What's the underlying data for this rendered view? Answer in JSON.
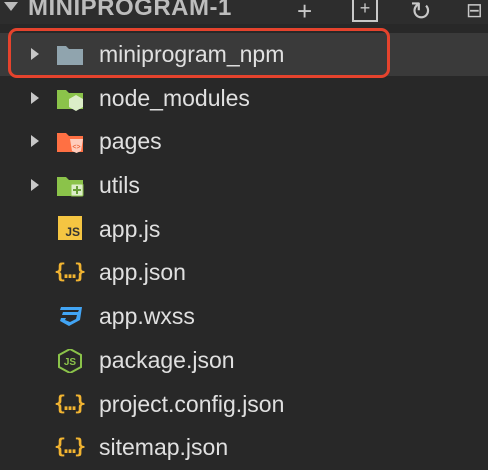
{
  "header": {
    "title": "MINIPROGRAM-1",
    "actions": [
      "new-file",
      "new-folder",
      "refresh",
      "collapse-all"
    ]
  },
  "tree": [
    {
      "label": "miniprogram_npm",
      "type": "folder",
      "icon": "folder-icon",
      "color": "#90a4ae",
      "selected": true
    },
    {
      "label": "node_modules",
      "type": "folder",
      "icon": "folder-node-icon",
      "color": "#8bc34a"
    },
    {
      "label": "pages",
      "type": "folder",
      "icon": "folder-html-icon",
      "color": "#ff7043"
    },
    {
      "label": "utils",
      "type": "folder",
      "icon": "folder-utils-icon",
      "color": "#8bc34a"
    },
    {
      "label": "app.js",
      "type": "file",
      "icon": "js-file-icon",
      "color": "#f5c542"
    },
    {
      "label": "app.json",
      "type": "file",
      "icon": "json-file-icon",
      "color": "#f2b431"
    },
    {
      "label": "app.wxss",
      "type": "file",
      "icon": "css-file-icon",
      "color": "#42a5f5"
    },
    {
      "label": "package.json",
      "type": "file",
      "icon": "nodejs-file-icon",
      "color": "#8bc34a"
    },
    {
      "label": "project.config.json",
      "type": "file",
      "icon": "json-file-icon",
      "color": "#f2b431"
    },
    {
      "label": "sitemap.json",
      "type": "file",
      "icon": "json-file-icon",
      "color": "#f2b431"
    }
  ]
}
